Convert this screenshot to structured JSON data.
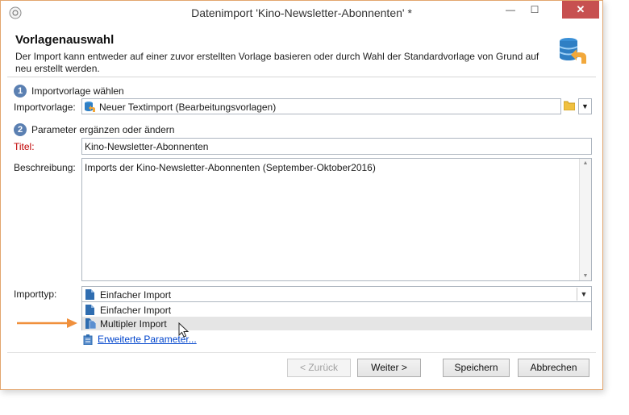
{
  "window": {
    "title": "Datenimport 'Kino-Newsletter-Abonnenten' *",
    "minimize": "—",
    "maximize": "☐",
    "close": "✕"
  },
  "header": {
    "title": "Vorlagenauswahl",
    "description": "Der Import kann entweder auf einer zuvor erstellten Vorlage basieren oder durch Wahl der Standardvorlage von Grund auf neu erstellt werden."
  },
  "step1": {
    "number": "1",
    "label": "Importvorlage wählen"
  },
  "template": {
    "label": "Importvorlage:",
    "value": "Neuer Textimport (Bearbeitungsvorlagen)"
  },
  "step2": {
    "number": "2",
    "label": "Parameter ergänzen oder ändern"
  },
  "title_field": {
    "label": "Titel:",
    "value": "Kino-Newsletter-Abonnenten"
  },
  "description_field": {
    "label": "Beschreibung:",
    "value": "Imports der Kino-Newsletter-Abonnenten (September-Oktober2016)"
  },
  "import_type": {
    "label": "Importtyp:",
    "value": "Einfacher Import",
    "options": [
      "Einfacher Import",
      "Multipler Import"
    ]
  },
  "advanced_link": "Erweiterte Parameter...",
  "buttons": {
    "back": "< Zurück",
    "next": "Weiter >",
    "save": "Speichern",
    "cancel": "Abbrechen"
  },
  "colors": {
    "accent": "#5b80b2",
    "arrow": "#f0903c",
    "close": "#c75050",
    "link": "#0044cc",
    "required": "#c00000"
  }
}
